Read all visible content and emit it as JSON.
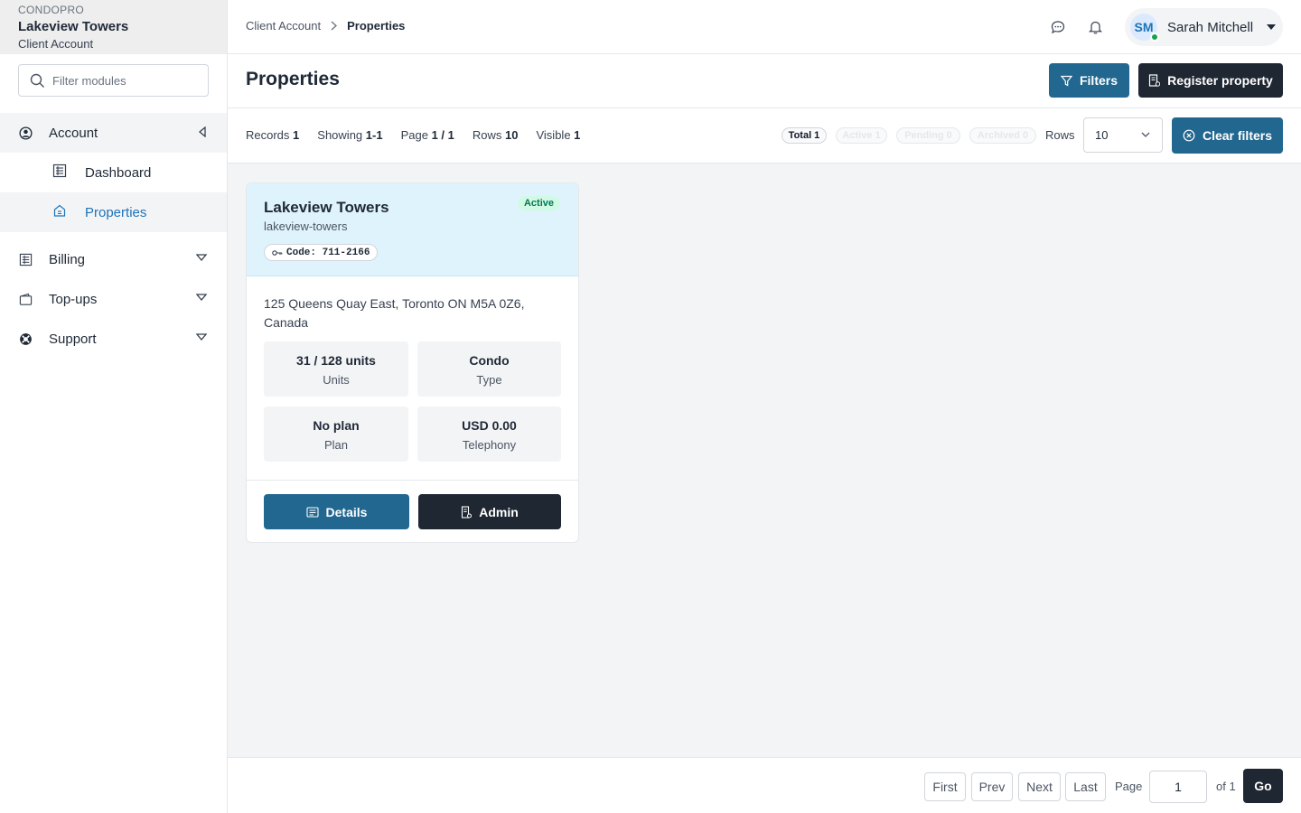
{
  "brand": {
    "app": "CONDOPRO",
    "property": "Lakeview Towers",
    "context": "Client Account"
  },
  "sidebar": {
    "filter_placeholder": "Filter modules",
    "items": [
      {
        "label": "Account",
        "icon": "user-circle-icon",
        "state": "expanded"
      },
      {
        "label": "Dashboard",
        "icon": "list-icon"
      },
      {
        "label": "Properties",
        "icon": "building-icon",
        "state": "active"
      },
      {
        "label": "Billing",
        "icon": "invoice-icon"
      },
      {
        "label": "Top-ups",
        "icon": "wallet-icon"
      },
      {
        "label": "Support",
        "icon": "lifebuoy-icon"
      }
    ]
  },
  "header": {
    "breadcrumb": [
      "Client Account",
      "Properties"
    ],
    "user": {
      "initials": "SM",
      "name": "Sarah Mitchell",
      "status": "online"
    }
  },
  "page": {
    "title": "Properties",
    "filters_label": "Filters",
    "register_label": "Register property"
  },
  "stats": {
    "records_label": "Records",
    "records": "1",
    "showing_label": "Showing",
    "showing": "1-1",
    "page_label": "Page",
    "page": "1 / 1",
    "rows_label": "Rows",
    "rows": "10",
    "visible_label": "Visible",
    "visible": "1"
  },
  "chips": [
    {
      "label": "Total 1",
      "enabled": true
    },
    {
      "label": "Active 1",
      "enabled": false
    },
    {
      "label": "Pending 0",
      "enabled": false
    },
    {
      "label": "Archived 0",
      "enabled": false
    }
  ],
  "rows_select": {
    "label": "Rows",
    "value": "10"
  },
  "clear_filters_label": "Clear filters",
  "property_card": {
    "name": "Lakeview Towers",
    "slug": "lakeview-towers",
    "code": "Code: 711-2166",
    "status": "Active",
    "address": "125 Queens Quay East, Toronto ON M5A 0Z6, Canada",
    "tiles": [
      {
        "value": "31 / 128 units",
        "label": "Units"
      },
      {
        "value": "Condo",
        "label": "Type"
      },
      {
        "value": "No plan",
        "label": "Plan"
      },
      {
        "value": "USD 0.00",
        "label": "Telephony"
      }
    ],
    "details_label": "Details",
    "admin_label": "Admin"
  },
  "pagination": {
    "first": "First",
    "prev": "Prev",
    "next": "Next",
    "last": "Last",
    "page_label": "Page",
    "page_value": "1",
    "of_label": "of 1",
    "go": "Go"
  },
  "colors": {
    "primary": "#22678f",
    "dark": "#1f2733",
    "accent_link": "#1e73b8",
    "success": "#047857"
  }
}
